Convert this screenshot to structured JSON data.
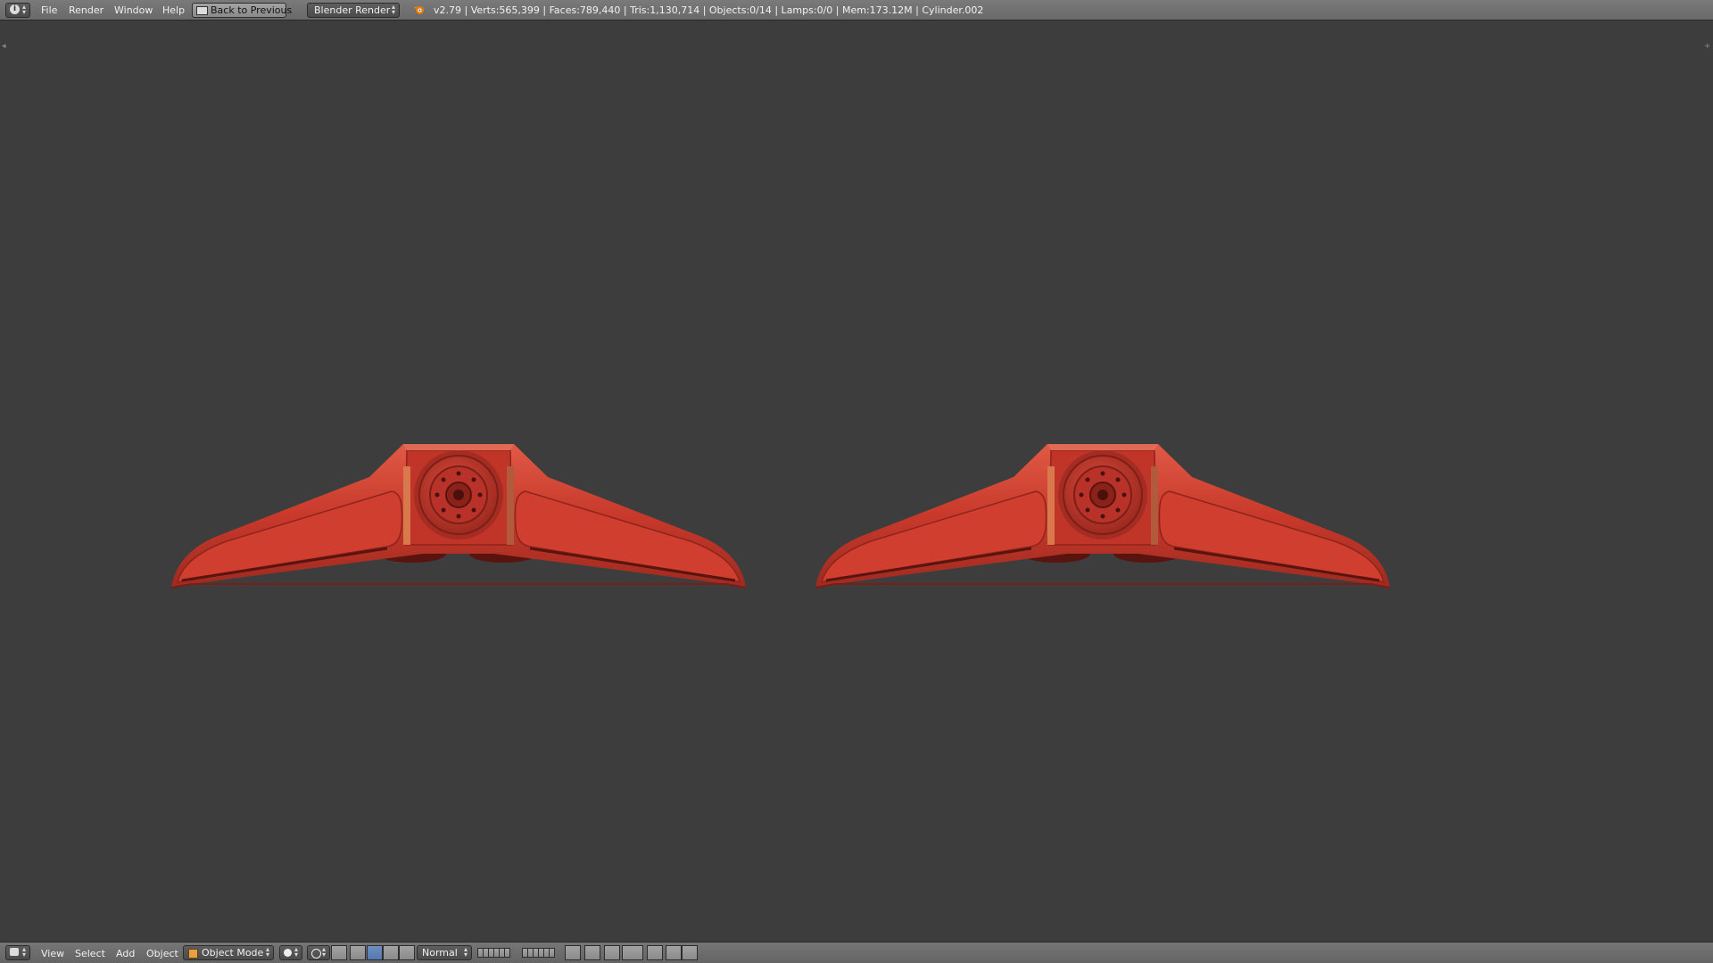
{
  "top_menu": {
    "items": [
      "File",
      "Render",
      "Window",
      "Help"
    ],
    "back_button": "Back to Previous",
    "render_engine": "Blender Render",
    "status": "v2.79 | Verts:565,399 | Faces:789,440 | Tris:1,130,714 | Objects:0/14 | Lamps:0/0 | Mem:173.12M | Cylinder.002"
  },
  "bottom_bar": {
    "menu": [
      "View",
      "Select",
      "Add",
      "Object"
    ],
    "mode": "Object Mode",
    "orientation": "Normal"
  },
  "colors": {
    "model": "#c8392b",
    "viewport_bg": "#3d3d3d"
  }
}
